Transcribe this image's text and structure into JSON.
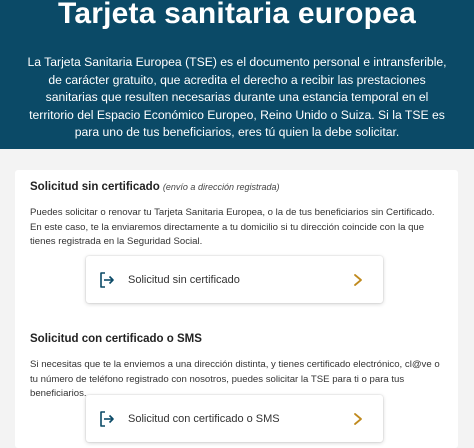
{
  "hero": {
    "title": "Tarjeta sanitaria europea",
    "description": "La Tarjeta Sanitaria Europea (TSE) es el documento personal e intransferible, de carácter gratuito, que acredita el derecho a recibir las prestaciones sanitarias que resulten necesarias durante una estancia temporal en el territorio del Espacio Económico Europeo, Reino Unido o Suiza. Si la TSE es para uno de tus beneficiarios, eres tú quien la debe solicitar."
  },
  "sections": [
    {
      "title": "Solicitud sin certificado",
      "note": "(envío a dirección registrada)",
      "description": "Puedes solicitar o renovar tu Tarjeta Sanitaria Europea, o la de tus beneficiarios sin Certificado. En este caso, te la enviaremos directamente a tu domicilio si tu dirección coincide con la que tienes registrada en la Seguridad Social.",
      "action_label": "Solicitud sin certificado",
      "action_icon": "login-icon"
    },
    {
      "title": "Solicitud con certificado o SMS",
      "note": "",
      "description": "Si necesitas que te la enviemos a una dirección distinta, y tienes certificado electrónico, cl@ve o tu número de teléfono registrado con nosotros, puedes solicitar la TSE para ti o para tus beneficiarios.",
      "action_label": "Solicitud con certificado o SMS",
      "action_icon": "login-icon"
    }
  ],
  "colors": {
    "hero_bg": "#0b4a67",
    "icon_color": "#0b4a67",
    "chevron_color": "#c08a1e"
  }
}
